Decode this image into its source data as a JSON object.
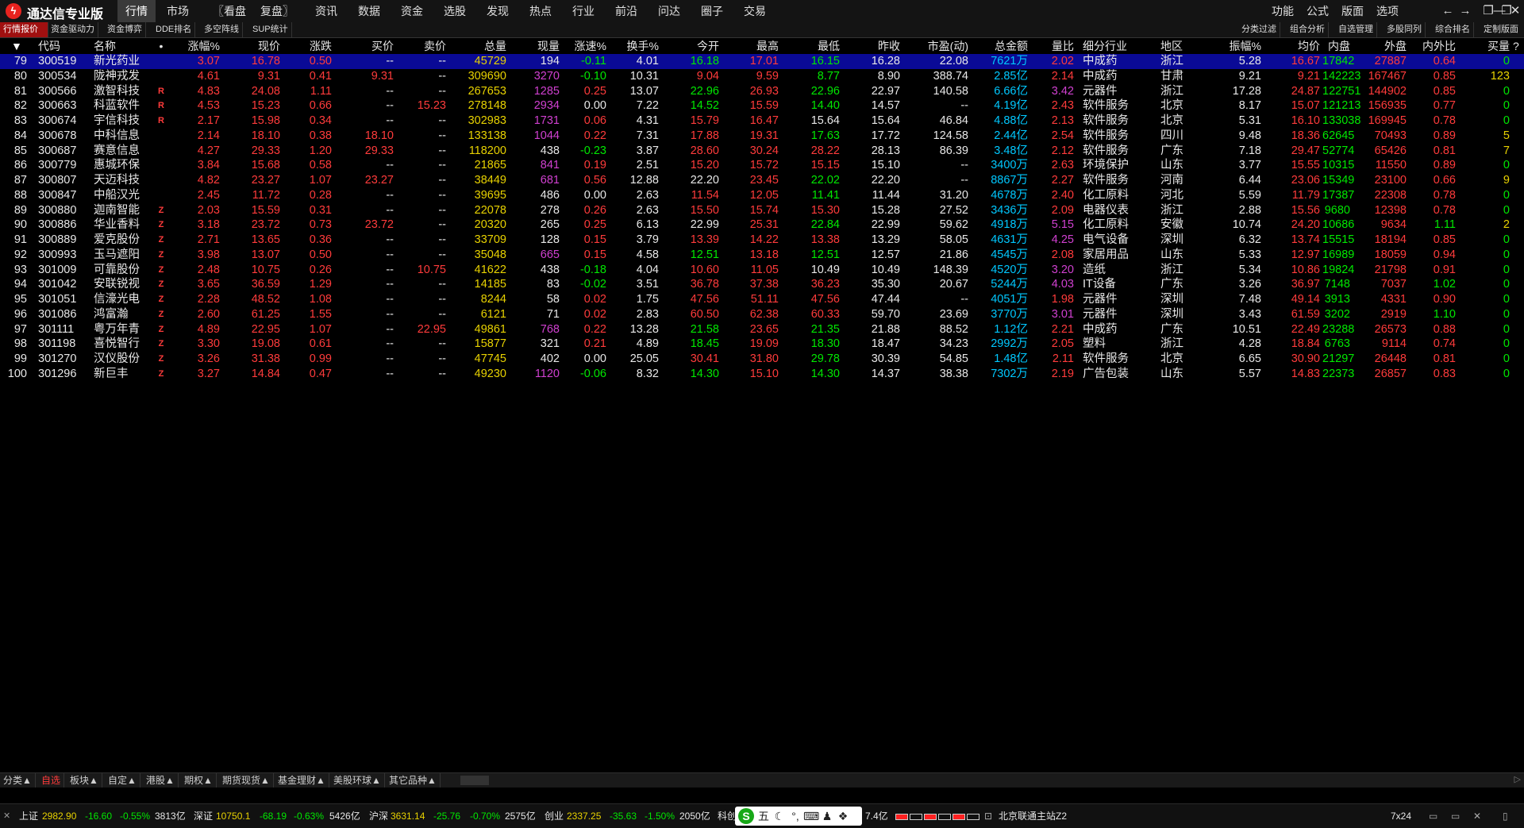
{
  "app": {
    "logo_glyph": "ϟ",
    "title": "通达信专业版"
  },
  "menu": [
    "行情",
    "市场",
    "〖看盘",
    "复盘〗",
    "资讯",
    "数据",
    "资金",
    "选股",
    "发现",
    "热点",
    "行业",
    "前沿",
    "问达",
    "圈子",
    "交易"
  ],
  "right_menu": [
    "功能",
    "公式",
    "版面",
    "选项"
  ],
  "window_buttons": [
    "←",
    "→",
    "❐",
    "—",
    "❐",
    "✕"
  ],
  "tabs_left": [
    "行情报价",
    "资金驱动力",
    "资金博弈",
    "DDE排名",
    "多空阵线",
    "SUP统计"
  ],
  "tabs_right": [
    "分类过滤",
    "组合分析",
    "自选管理",
    "多股同列",
    "综合排名",
    "定制版面"
  ],
  "columns": [
    "代码",
    "名称",
    "•",
    "涨幅%",
    "现价",
    "涨跌",
    "买价",
    "卖价",
    "总量",
    "现量",
    "涨速%",
    "换手%",
    "今开",
    "最高",
    "最低",
    "昨收",
    "市盈(动)",
    "总金额",
    "量比",
    "细分行业",
    "地区",
    "振幅%",
    "均价",
    "内盘",
    "外盘",
    "内外比",
    "买量"
  ],
  "sort_arrow": "▼",
  "header_end_glyph": "?",
  "rows": [
    {
      "n": "79",
      "code": "300519",
      "name": "新光药业",
      "tag": "",
      "chg_pct": "3.07",
      "price": "16.78",
      "chg": "0.50",
      "bid": "--",
      "ask": "--",
      "vol": "45729",
      "cur": "194",
      "speed": "-0.11",
      "turn": "4.01",
      "open": "16.18",
      "high": "17.01",
      "low": "16.15",
      "prev": "16.28",
      "pe": "22.08",
      "amount": "7621万",
      "vr": "2.02",
      "industry": "中成药",
      "region": "浙江",
      "amp": "5.28",
      "avg": "16.67",
      "inner": "17842",
      "outer": "27887",
      "io": "0.64",
      "bidvol": "0"
    },
    {
      "n": "80",
      "code": "300534",
      "name": "陇神戎发",
      "tag": "",
      "chg_pct": "4.61",
      "price": "9.31",
      "chg": "0.41",
      "bid": "9.31",
      "ask": "--",
      "vol": "309690",
      "cur": "3270",
      "speed": "-0.10",
      "turn": "10.31",
      "open": "9.04",
      "high": "9.59",
      "low": "8.77",
      "prev": "8.90",
      "pe": "388.74",
      "amount": "2.85亿",
      "vr": "2.14",
      "industry": "中成药",
      "region": "甘肃",
      "amp": "9.21",
      "avg": "9.21",
      "inner": "142223",
      "outer": "167467",
      "io": "0.85",
      "bidvol": "123"
    },
    {
      "n": "81",
      "code": "300566",
      "name": "激智科技",
      "tag": "R",
      "chg_pct": "4.83",
      "price": "24.08",
      "chg": "1.11",
      "bid": "--",
      "ask": "--",
      "vol": "267653",
      "cur": "1285",
      "speed": "0.25",
      "turn": "13.07",
      "open": "22.96",
      "high": "26.93",
      "low": "22.96",
      "prev": "22.97",
      "pe": "140.58",
      "amount": "6.66亿",
      "vr": "3.42",
      "industry": "元器件",
      "region": "浙江",
      "amp": "17.28",
      "avg": "24.87",
      "inner": "122751",
      "outer": "144902",
      "io": "0.85",
      "bidvol": "0"
    },
    {
      "n": "82",
      "code": "300663",
      "name": "科蓝软件",
      "tag": "R",
      "chg_pct": "4.53",
      "price": "15.23",
      "chg": "0.66",
      "bid": "--",
      "ask": "15.23",
      "vol": "278148",
      "cur": "2934",
      "speed": "0.00",
      "turn": "7.22",
      "open": "14.52",
      "high": "15.59",
      "low": "14.40",
      "prev": "14.57",
      "pe": "--",
      "amount": "4.19亿",
      "vr": "2.43",
      "industry": "软件服务",
      "region": "北京",
      "amp": "8.17",
      "avg": "15.07",
      "inner": "121213",
      "outer": "156935",
      "io": "0.77",
      "bidvol": "0"
    },
    {
      "n": "83",
      "code": "300674",
      "name": "宇信科技",
      "tag": "R",
      "chg_pct": "2.17",
      "price": "15.98",
      "chg": "0.34",
      "bid": "--",
      "ask": "--",
      "vol": "302983",
      "cur": "1731",
      "speed": "0.06",
      "turn": "4.31",
      "open": "15.79",
      "high": "16.47",
      "low": "15.64",
      "prev": "15.64",
      "pe": "46.84",
      "amount": "4.88亿",
      "vr": "2.13",
      "industry": "软件服务",
      "region": "北京",
      "amp": "5.31",
      "avg": "16.10",
      "inner": "133038",
      "outer": "169945",
      "io": "0.78",
      "bidvol": "0"
    },
    {
      "n": "84",
      "code": "300678",
      "name": "中科信息",
      "tag": "",
      "chg_pct": "2.14",
      "price": "18.10",
      "chg": "0.38",
      "bid": "18.10",
      "ask": "--",
      "vol": "133138",
      "cur": "1044",
      "speed": "0.22",
      "turn": "7.31",
      "open": "17.88",
      "high": "19.31",
      "low": "17.63",
      "prev": "17.72",
      "pe": "124.58",
      "amount": "2.44亿",
      "vr": "2.54",
      "industry": "软件服务",
      "region": "四川",
      "amp": "9.48",
      "avg": "18.36",
      "inner": "62645",
      "outer": "70493",
      "io": "0.89",
      "bidvol": "5"
    },
    {
      "n": "85",
      "code": "300687",
      "name": "赛意信息",
      "tag": "",
      "chg_pct": "4.27",
      "price": "29.33",
      "chg": "1.20",
      "bid": "29.33",
      "ask": "--",
      "vol": "118200",
      "cur": "438",
      "speed": "-0.23",
      "turn": "3.87",
      "open": "28.60",
      "high": "30.24",
      "low": "28.22",
      "prev": "28.13",
      "pe": "86.39",
      "amount": "3.48亿",
      "vr": "2.12",
      "industry": "软件服务",
      "region": "广东",
      "amp": "7.18",
      "avg": "29.47",
      "inner": "52774",
      "outer": "65426",
      "io": "0.81",
      "bidvol": "7"
    },
    {
      "n": "86",
      "code": "300779",
      "name": "惠城环保",
      "tag": "",
      "chg_pct": "3.84",
      "price": "15.68",
      "chg": "0.58",
      "bid": "--",
      "ask": "--",
      "vol": "21865",
      "cur": "841",
      "speed": "0.19",
      "turn": "2.51",
      "open": "15.20",
      "high": "15.72",
      "low": "15.15",
      "prev": "15.10",
      "pe": "--",
      "amount": "3400万",
      "vr": "2.63",
      "industry": "环境保护",
      "region": "山东",
      "amp": "3.77",
      "avg": "15.55",
      "inner": "10315",
      "outer": "11550",
      "io": "0.89",
      "bidvol": "0"
    },
    {
      "n": "87",
      "code": "300807",
      "name": "天迈科技",
      "tag": "",
      "chg_pct": "4.82",
      "price": "23.27",
      "chg": "1.07",
      "bid": "23.27",
      "ask": "--",
      "vol": "38449",
      "cur": "681",
      "speed": "0.56",
      "turn": "12.88",
      "open": "22.20",
      "high": "23.45",
      "low": "22.02",
      "prev": "22.20",
      "pe": "--",
      "amount": "8867万",
      "vr": "2.27",
      "industry": "软件服务",
      "region": "河南",
      "amp": "6.44",
      "avg": "23.06",
      "inner": "15349",
      "outer": "23100",
      "io": "0.66",
      "bidvol": "9"
    },
    {
      "n": "88",
      "code": "300847",
      "name": "中船汉光",
      "tag": "",
      "chg_pct": "2.45",
      "price": "11.72",
      "chg": "0.28",
      "bid": "--",
      "ask": "--",
      "vol": "39695",
      "cur": "486",
      "speed": "0.00",
      "turn": "2.63",
      "open": "11.54",
      "high": "12.05",
      "low": "11.41",
      "prev": "11.44",
      "pe": "31.20",
      "amount": "4678万",
      "vr": "2.40",
      "industry": "化工原料",
      "region": "河北",
      "amp": "5.59",
      "avg": "11.79",
      "inner": "17387",
      "outer": "22308",
      "io": "0.78",
      "bidvol": "0"
    },
    {
      "n": "89",
      "code": "300880",
      "name": "迦南智能",
      "tag": "Z",
      "chg_pct": "2.03",
      "price": "15.59",
      "chg": "0.31",
      "bid": "--",
      "ask": "--",
      "vol": "22078",
      "cur": "278",
      "speed": "0.26",
      "turn": "2.63",
      "open": "15.50",
      "high": "15.74",
      "low": "15.30",
      "prev": "15.28",
      "pe": "27.52",
      "amount": "3436万",
      "vr": "2.09",
      "industry": "电器仪表",
      "region": "浙江",
      "amp": "2.88",
      "avg": "15.56",
      "inner": "9680",
      "outer": "12398",
      "io": "0.78",
      "bidvol": "0"
    },
    {
      "n": "90",
      "code": "300886",
      "name": "华业香料",
      "tag": "Z",
      "chg_pct": "3.18",
      "price": "23.72",
      "chg": "0.73",
      "bid": "23.72",
      "ask": "--",
      "vol": "20320",
      "cur": "265",
      "speed": "0.25",
      "turn": "6.13",
      "open": "22.99",
      "high": "25.31",
      "low": "22.84",
      "prev": "22.99",
      "pe": "59.62",
      "amount": "4918万",
      "vr": "5.15",
      "industry": "化工原料",
      "region": "安徽",
      "amp": "10.74",
      "avg": "24.20",
      "inner": "10686",
      "outer": "9634",
      "io": "1.11",
      "bidvol": "2"
    },
    {
      "n": "91",
      "code": "300889",
      "name": "爱克股份",
      "tag": "Z",
      "chg_pct": "2.71",
      "price": "13.65",
      "chg": "0.36",
      "bid": "--",
      "ask": "--",
      "vol": "33709",
      "cur": "128",
      "speed": "0.15",
      "turn": "3.79",
      "open": "13.39",
      "high": "14.22",
      "low": "13.38",
      "prev": "13.29",
      "pe": "58.05",
      "amount": "4631万",
      "vr": "4.25",
      "industry": "电气设备",
      "region": "深圳",
      "amp": "6.32",
      "avg": "13.74",
      "inner": "15515",
      "outer": "18194",
      "io": "0.85",
      "bidvol": "0"
    },
    {
      "n": "92",
      "code": "300993",
      "name": "玉马遮阳",
      "tag": "Z",
      "chg_pct": "3.98",
      "price": "13.07",
      "chg": "0.50",
      "bid": "--",
      "ask": "--",
      "vol": "35048",
      "cur": "665",
      "speed": "0.15",
      "turn": "4.58",
      "open": "12.51",
      "high": "13.18",
      "low": "12.51",
      "prev": "12.57",
      "pe": "21.86",
      "amount": "4545万",
      "vr": "2.08",
      "industry": "家居用品",
      "region": "山东",
      "amp": "5.33",
      "avg": "12.97",
      "inner": "16989",
      "outer": "18059",
      "io": "0.94",
      "bidvol": "0"
    },
    {
      "n": "93",
      "code": "301009",
      "name": "可靠股份",
      "tag": "Z",
      "chg_pct": "2.48",
      "price": "10.75",
      "chg": "0.26",
      "bid": "--",
      "ask": "10.75",
      "vol": "41622",
      "cur": "438",
      "speed": "-0.18",
      "turn": "4.04",
      "open": "10.60",
      "high": "11.05",
      "low": "10.49",
      "prev": "10.49",
      "pe": "148.39",
      "amount": "4520万",
      "vr": "3.20",
      "industry": "造纸",
      "region": "浙江",
      "amp": "5.34",
      "avg": "10.86",
      "inner": "19824",
      "outer": "21798",
      "io": "0.91",
      "bidvol": "0"
    },
    {
      "n": "94",
      "code": "301042",
      "name": "安联锐视",
      "tag": "Z",
      "chg_pct": "3.65",
      "price": "36.59",
      "chg": "1.29",
      "bid": "--",
      "ask": "--",
      "vol": "14185",
      "cur": "83",
      "speed": "-0.02",
      "turn": "3.51",
      "open": "36.78",
      "high": "37.38",
      "low": "36.23",
      "prev": "35.30",
      "pe": "20.67",
      "amount": "5244万",
      "vr": "4.03",
      "industry": "IT设备",
      "region": "广东",
      "amp": "3.26",
      "avg": "36.97",
      "inner": "7148",
      "outer": "7037",
      "io": "1.02",
      "bidvol": "0"
    },
    {
      "n": "95",
      "code": "301051",
      "name": "信濠光电",
      "tag": "Z",
      "chg_pct": "2.28",
      "price": "48.52",
      "chg": "1.08",
      "bid": "--",
      "ask": "--",
      "vol": "8244",
      "cur": "58",
      "speed": "0.02",
      "turn": "1.75",
      "open": "47.56",
      "high": "51.11",
      "low": "47.56",
      "prev": "47.44",
      "pe": "--",
      "amount": "4051万",
      "vr": "1.98",
      "industry": "元器件",
      "region": "深圳",
      "amp": "7.48",
      "avg": "49.14",
      "inner": "3913",
      "outer": "4331",
      "io": "0.90",
      "bidvol": "0"
    },
    {
      "n": "96",
      "code": "301086",
      "name": "鸿富瀚",
      "tag": "Z",
      "chg_pct": "2.60",
      "price": "61.25",
      "chg": "1.55",
      "bid": "--",
      "ask": "--",
      "vol": "6121",
      "cur": "71",
      "speed": "0.02",
      "turn": "2.83",
      "open": "60.50",
      "high": "62.38",
      "low": "60.33",
      "prev": "59.70",
      "pe": "23.69",
      "amount": "3770万",
      "vr": "3.01",
      "industry": "元器件",
      "region": "深圳",
      "amp": "3.43",
      "avg": "61.59",
      "inner": "3202",
      "outer": "2919",
      "io": "1.10",
      "bidvol": "0"
    },
    {
      "n": "97",
      "code": "301111",
      "name": "粤万年青",
      "tag": "Z",
      "chg_pct": "4.89",
      "price": "22.95",
      "chg": "1.07",
      "bid": "--",
      "ask": "22.95",
      "vol": "49861",
      "cur": "768",
      "speed": "0.22",
      "turn": "13.28",
      "open": "21.58",
      "high": "23.65",
      "low": "21.35",
      "prev": "21.88",
      "pe": "88.52",
      "amount": "1.12亿",
      "vr": "2.21",
      "industry": "中成药",
      "region": "广东",
      "amp": "10.51",
      "avg": "22.49",
      "inner": "23288",
      "outer": "26573",
      "io": "0.88",
      "bidvol": "0"
    },
    {
      "n": "98",
      "code": "301198",
      "name": "喜悦智行",
      "tag": "Z",
      "chg_pct": "3.30",
      "price": "19.08",
      "chg": "0.61",
      "bid": "--",
      "ask": "--",
      "vol": "15877",
      "cur": "321",
      "speed": "0.21",
      "turn": "4.89",
      "open": "18.45",
      "high": "19.09",
      "low": "18.30",
      "prev": "18.47",
      "pe": "34.23",
      "amount": "2992万",
      "vr": "2.05",
      "industry": "塑料",
      "region": "浙江",
      "amp": "4.28",
      "avg": "18.84",
      "inner": "6763",
      "outer": "9114",
      "io": "0.74",
      "bidvol": "0"
    },
    {
      "n": "99",
      "code": "301270",
      "name": "汉仪股份",
      "tag": "Z",
      "chg_pct": "3.26",
      "price": "31.38",
      "chg": "0.99",
      "bid": "--",
      "ask": "--",
      "vol": "47745",
      "cur": "402",
      "speed": "0.00",
      "turn": "25.05",
      "open": "30.41",
      "high": "31.80",
      "low": "29.78",
      "prev": "30.39",
      "pe": "54.85",
      "amount": "1.48亿",
      "vr": "2.11",
      "industry": "软件服务",
      "region": "北京",
      "amp": "6.65",
      "avg": "30.90",
      "inner": "21297",
      "outer": "26448",
      "io": "0.81",
      "bidvol": "0"
    },
    {
      "n": "100",
      "code": "301296",
      "name": "新巨丰",
      "tag": "Z",
      "chg_pct": "3.27",
      "price": "14.84",
      "chg": "0.47",
      "bid": "--",
      "ask": "--",
      "vol": "49230",
      "cur": "1120",
      "speed": "-0.06",
      "turn": "8.32",
      "open": "14.30",
      "high": "15.10",
      "low": "14.30",
      "prev": "14.37",
      "pe": "38.38",
      "amount": "7302万",
      "vr": "2.19",
      "industry": "广告包装",
      "region": "山东",
      "amp": "5.57",
      "avg": "14.83",
      "inner": "22373",
      "outer": "26857",
      "io": "0.83",
      "bidvol": "0"
    }
  ],
  "sheet_tabs": [
    "分类▲",
    "自选",
    "板块▲",
    "自定▲",
    "港股▲",
    "期权▲",
    "期货现货▲",
    "基金理财▲",
    "美股环球▲",
    "其它品种▲"
  ],
  "sheet_scroll_glyph": "▷",
  "status": {
    "close_icon": "✕",
    "sh": {
      "label": "上证",
      "value": "2982.90",
      "chg": "-16.60",
      "pct": "-0.55%",
      "amt": "3813亿"
    },
    "sz": {
      "label": "深证",
      "value": "10750.1",
      "chg": "-68.19",
      "pct": "-0.63%",
      "amt": "5426亿"
    },
    "hs": {
      "label": "沪深",
      "value": "3631.14",
      "chg": "-25.76",
      "pct": "-0.70%",
      "amt": "2575亿"
    },
    "cy": {
      "label": "创业",
      "value": "2337.25",
      "chg": "-35.63",
      "pct": "-1.50%",
      "amt": "2050亿"
    },
    "kc_label": "科创",
    "kc_amt": "7.4亿",
    "ime": {
      "logo": "S",
      "mode": "五",
      "moon": "☾",
      "punct": "°,",
      "keyboard": "⌨",
      "user": "♟",
      "apps": "❖"
    },
    "lamp_states": [
      true,
      false,
      true,
      false,
      true,
      false
    ],
    "server_icon": "⊡",
    "server": "北京联通主站Z2",
    "uptime": "7x24",
    "tray": [
      "▭",
      "▭",
      "✕",
      "▯"
    ]
  }
}
